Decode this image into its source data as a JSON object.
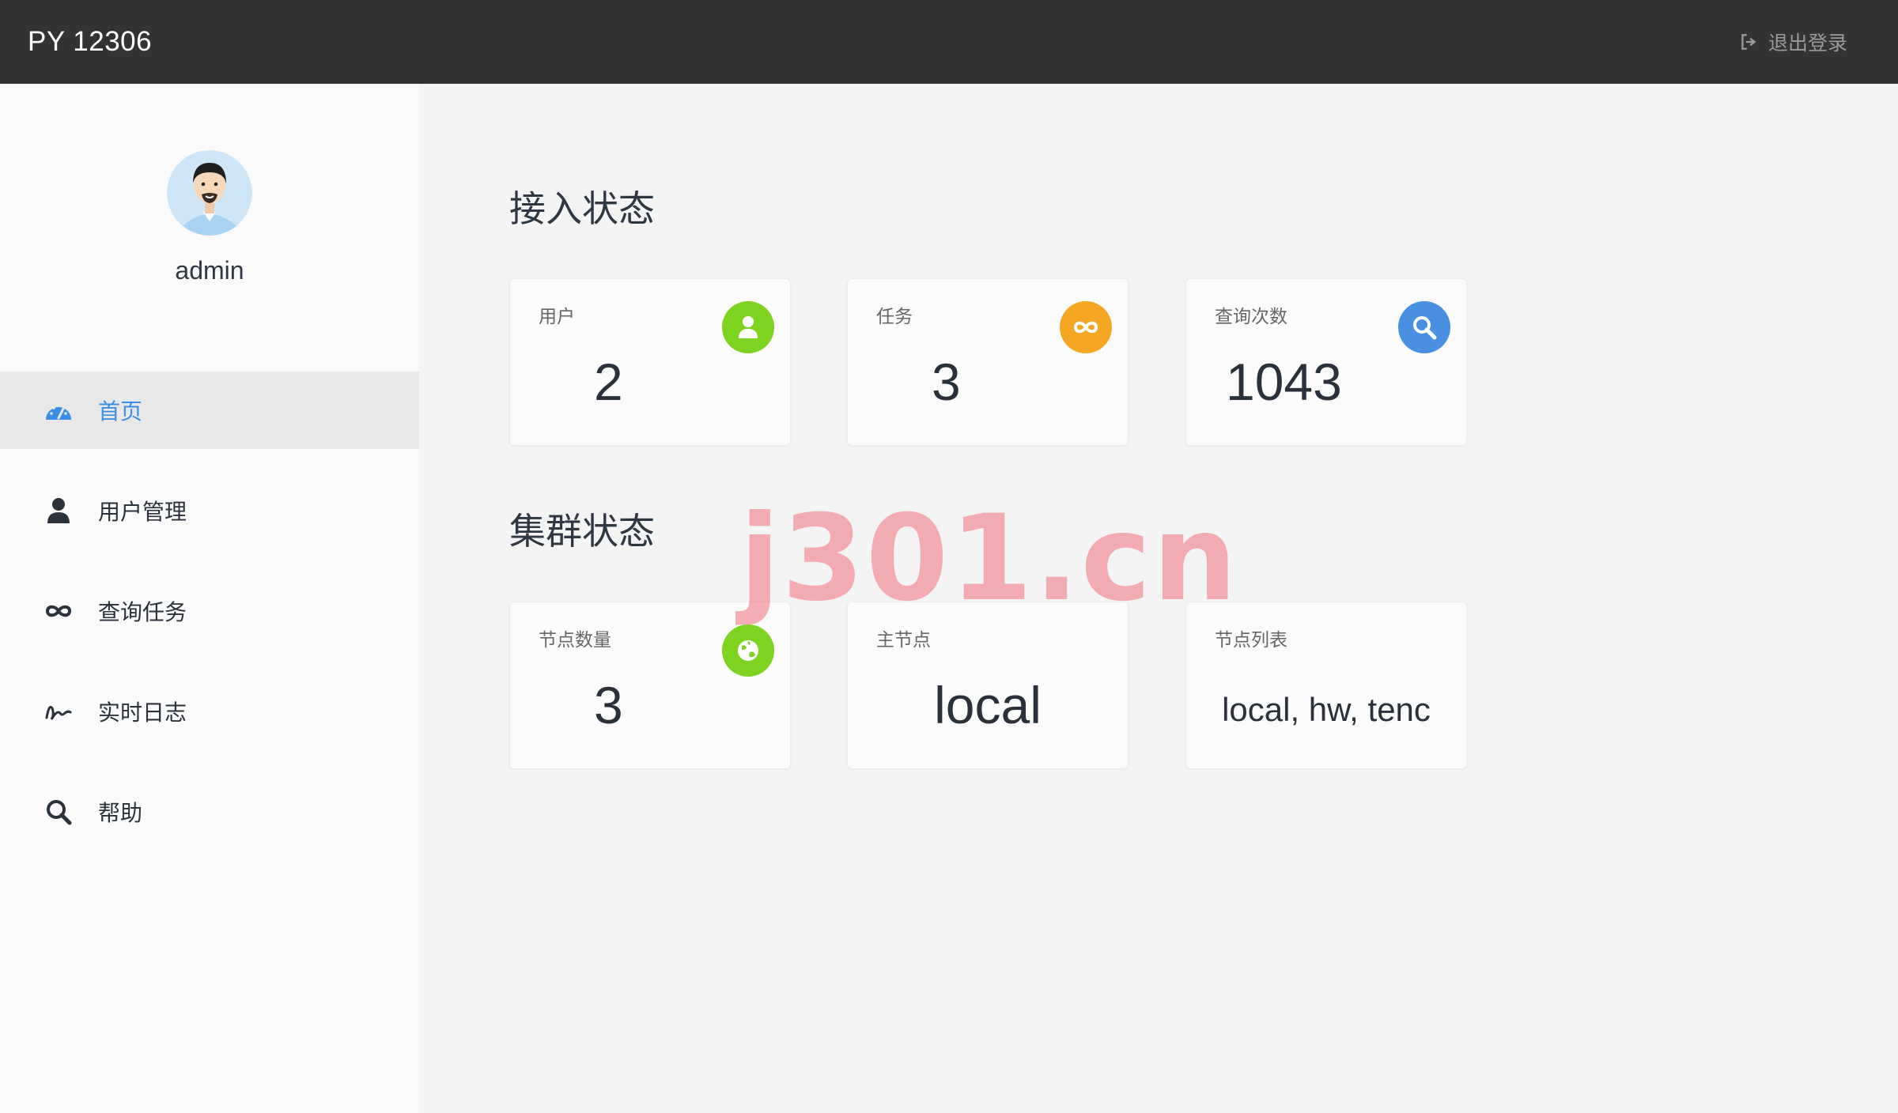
{
  "header": {
    "brand": "PY 12306",
    "logout_label": "退出登录"
  },
  "profile": {
    "username": "admin"
  },
  "sidebar": {
    "items": [
      {
        "label": "首页",
        "icon": "dashboard-icon",
        "active": true
      },
      {
        "label": "用户管理",
        "icon": "user-icon",
        "active": false
      },
      {
        "label": "查询任务",
        "icon": "infinity-icon",
        "active": false
      },
      {
        "label": "实时日志",
        "icon": "signature-icon",
        "active": false
      },
      {
        "label": "帮助",
        "icon": "search-icon",
        "active": false
      }
    ]
  },
  "access_status": {
    "title": "接入状态",
    "cards": [
      {
        "label": "用户",
        "value": "2",
        "icon": "user-icon",
        "color": "#7ed321"
      },
      {
        "label": "任务",
        "value": "3",
        "icon": "infinity-icon",
        "color": "#f5a623"
      },
      {
        "label": "查询次数",
        "value": "1043",
        "icon": "search-icon",
        "color": "#4a90e2"
      }
    ]
  },
  "cluster_status": {
    "title": "集群状态",
    "cards": [
      {
        "label": "节点数量",
        "value": "3",
        "icon": "globe-icon",
        "color": "#7ed321"
      },
      {
        "label": "主节点",
        "value": "local"
      },
      {
        "label": "节点列表",
        "value": "local, hw, tenc"
      }
    ]
  },
  "watermark": "j301.cn"
}
